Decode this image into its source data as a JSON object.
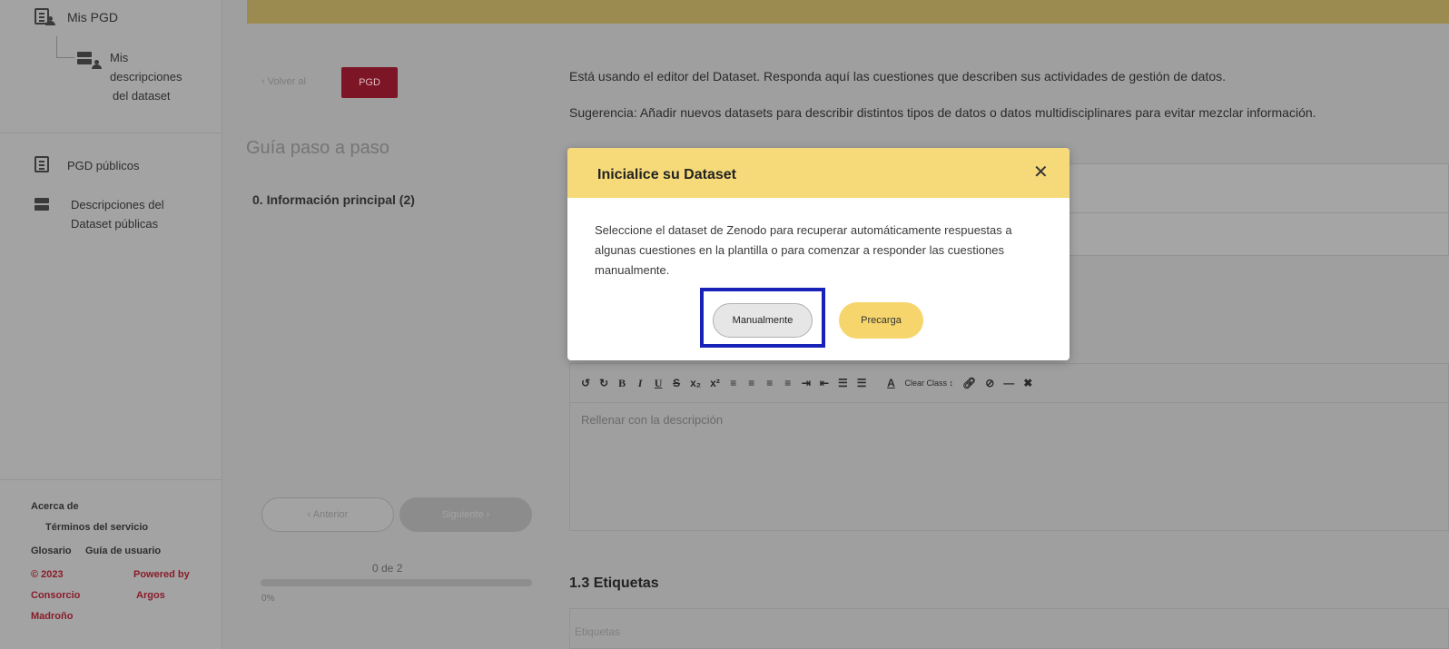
{
  "sidebar": {
    "my_dmps": "Mis PGD",
    "my_dataset_desc": [
      "Mis",
      "descripciones",
      "del dataset"
    ],
    "public_dmps": "PGD públicos",
    "public_dataset_desc": [
      "Descripciones del",
      "Dataset públicas"
    ],
    "footer": {
      "about": "Acerca de",
      "terms": "Términos del servicio",
      "glossary": "Glosario",
      "user_guide": "Guía de usuario",
      "copyright": "© 2023",
      "powered_by": "Powered by",
      "org": "Consorcio",
      "org2": "Madroño",
      "argos": "Argos"
    }
  },
  "nav": {
    "back_label": "Volver al",
    "back_button": "PGD",
    "guide_title": "Guía paso a paso",
    "section": "0. Información principal (2)",
    "prev": "Anterior",
    "next": "Siguiente",
    "progress_count": "0 de 2",
    "progress_percent": "0%",
    "progress_value": 0
  },
  "main": {
    "intro": "Está usando el editor del Dataset. Responda aquí las cuestiones que describen sus actividades de gestión de datos.",
    "suggestion": "Sugerencia: Añadir nuevos datasets para describir distintos tipos de datos o datos multidisciplinares para evitar mezclar información.",
    "editor_placeholder": "Rellenar con la descripción",
    "clear_class": "Clear Class",
    "tags_heading": "1.3 Etiquetas",
    "tags_placeholder": "Etiquetas"
  },
  "modal": {
    "title": "Inicialice su Dataset",
    "body": "Seleccione el dataset de Zenodo para recuperar automáticamente respuestas a algunas cuestiones en la plantilla o para comenzar a responder las cuestiones manualmente.",
    "manual": "Manualmente",
    "preload": "Precarga"
  },
  "colors": {
    "accent_yellow": "#f6da7a",
    "brand_red": "#7c1525",
    "highlight_blue": "#1822b8"
  }
}
